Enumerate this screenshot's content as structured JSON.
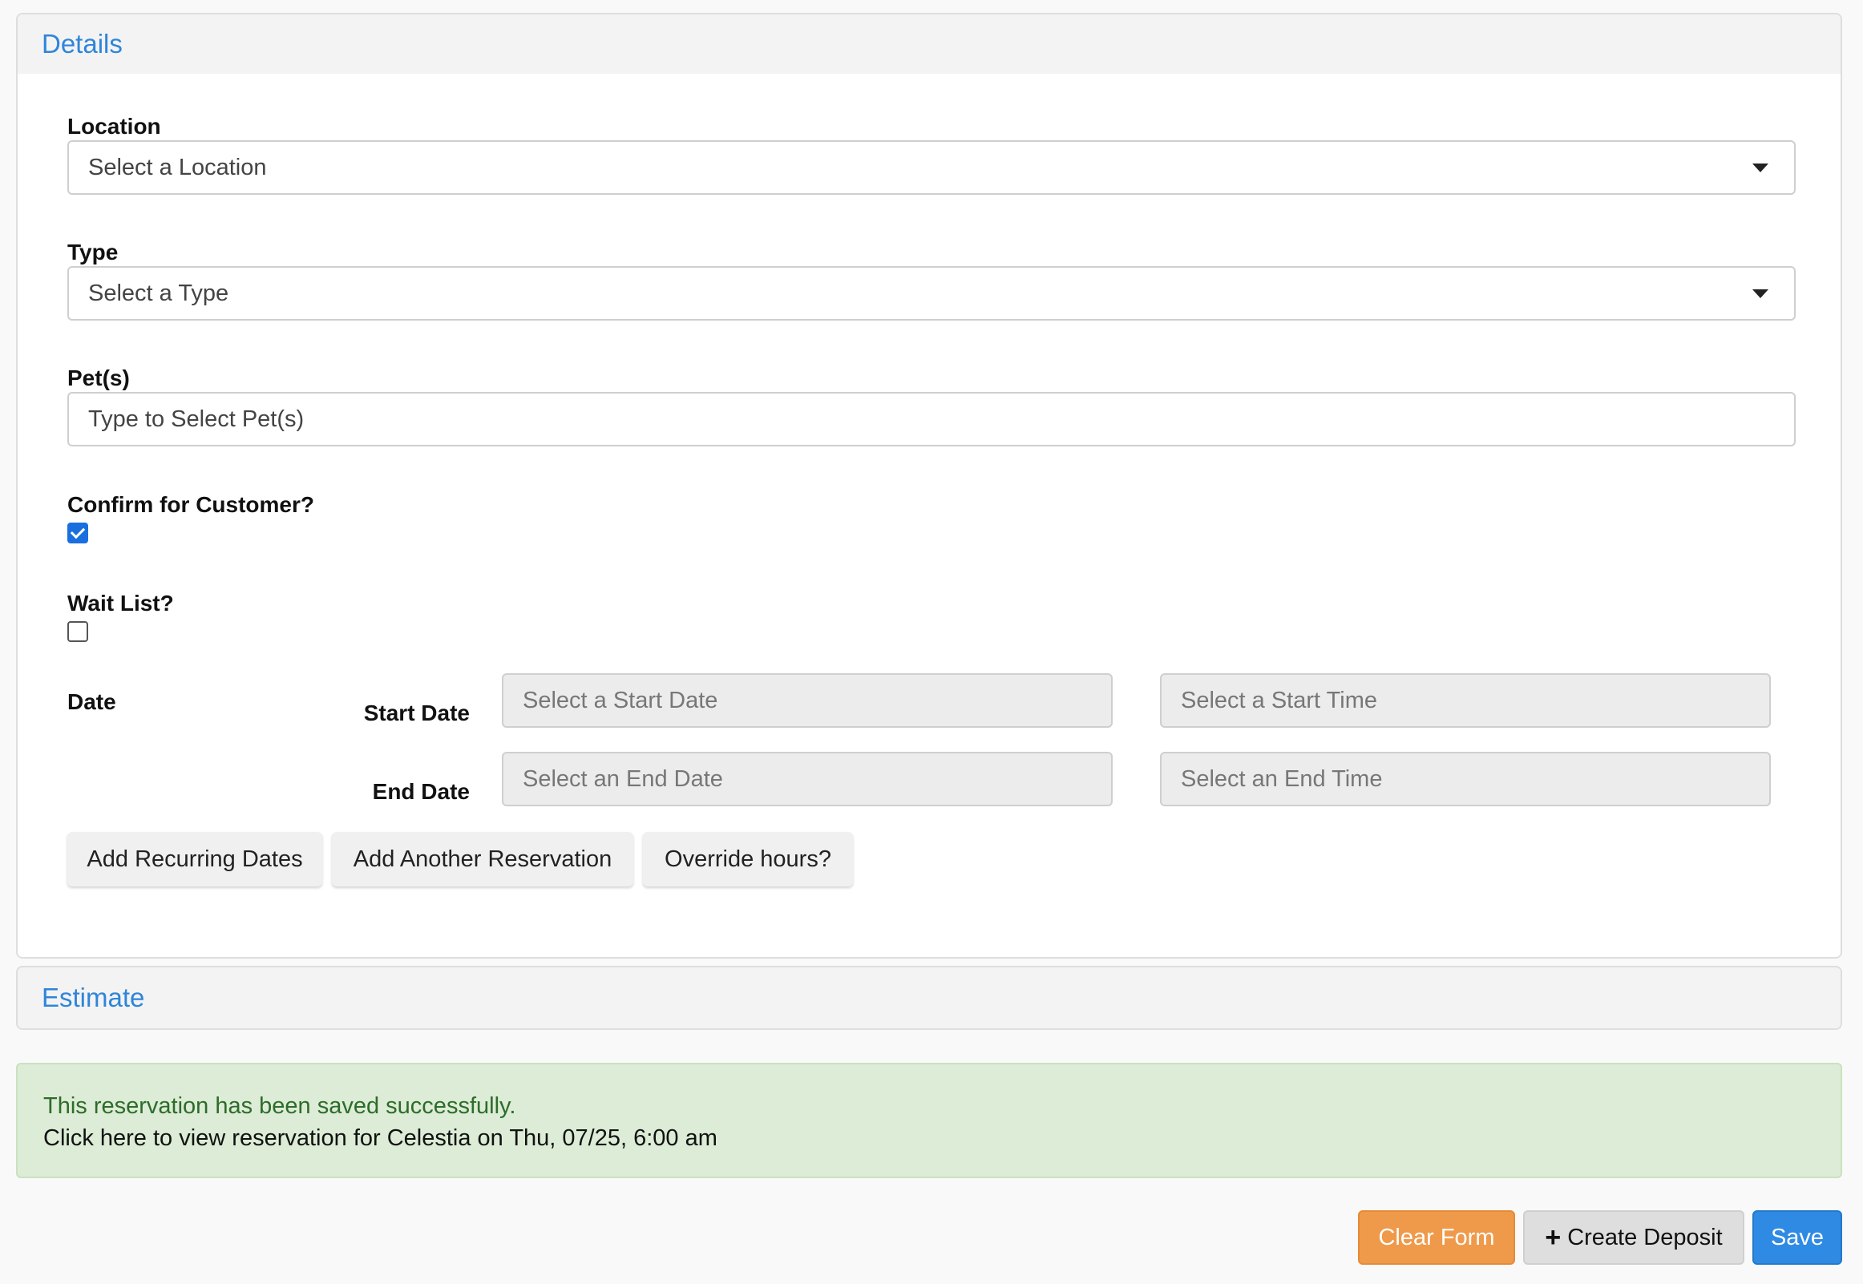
{
  "details": {
    "header": "Details",
    "location": {
      "label": "Location",
      "placeholder": "Select a Location"
    },
    "type": {
      "label": "Type",
      "placeholder": "Select a Type"
    },
    "pets": {
      "label": "Pet(s)",
      "placeholder": "Type to Select Pet(s)"
    },
    "confirm": {
      "label": "Confirm for Customer?",
      "checked": true
    },
    "waitlist": {
      "label": "Wait List?",
      "checked": false
    },
    "date": {
      "label": "Date",
      "start_label": "Start Date",
      "end_label": "End Date",
      "start_date_placeholder": "Select a Start Date",
      "start_time_placeholder": "Select a Start Time",
      "end_date_placeholder": "Select an End Date",
      "end_time_placeholder": "Select an End Time"
    },
    "buttons": {
      "recurring": "Add Recurring Dates",
      "another": "Add Another Reservation",
      "override": "Override hours?"
    }
  },
  "estimate": {
    "header": "Estimate"
  },
  "alert": {
    "message": "This reservation has been saved successfully.",
    "link": "Click here to view reservation for Celestia on Thu, 07/25, 6:00 am"
  },
  "footer": {
    "clear": "Clear Form",
    "deposit": "Create Deposit",
    "save": "Save"
  },
  "colors": {
    "accent": "#2f85d9",
    "success_bg": "#dcecd6",
    "clear_button": "#ef9a4a",
    "save_button": "#2f8ae3"
  },
  "icons": {
    "dropdown": "caret-down-icon",
    "deposit": "plus-icon",
    "checkbox_checked": "checkmark-icon"
  }
}
